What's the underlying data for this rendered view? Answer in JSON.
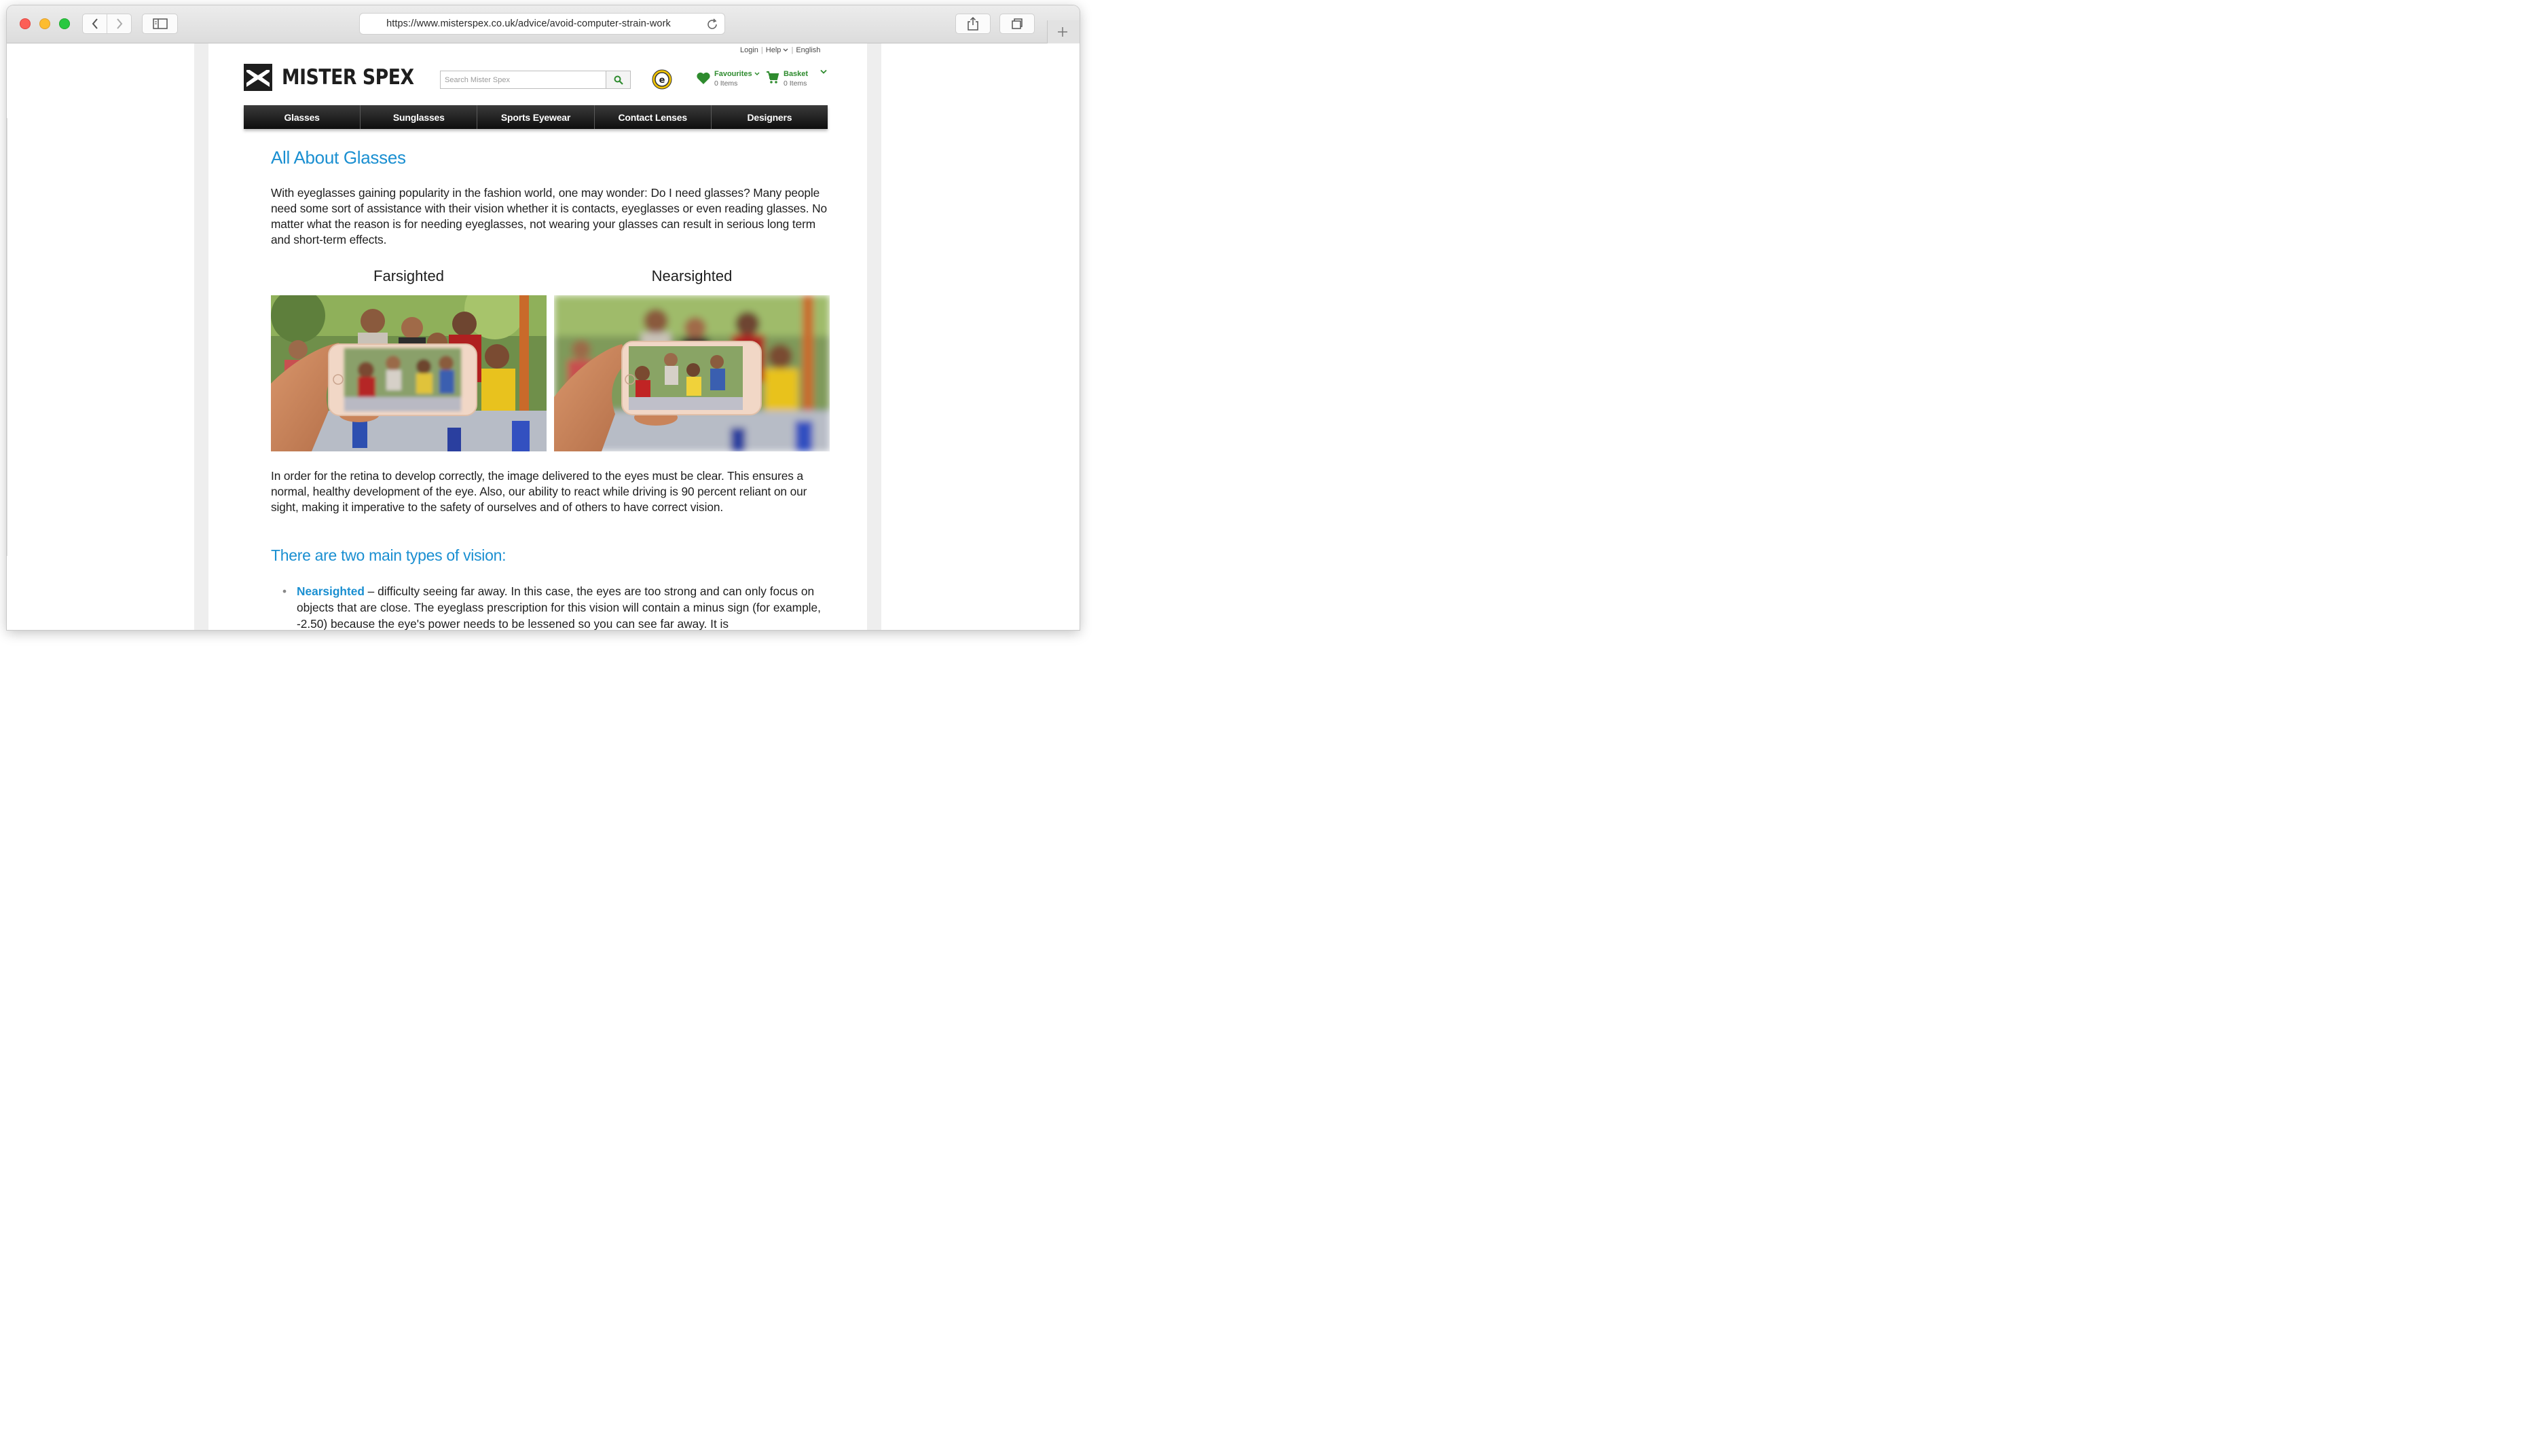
{
  "browser": {
    "url": "https://www.misterspex.co.uk/advice/avoid-computer-strain-work"
  },
  "site": {
    "top_links": [
      "Login",
      "Help",
      "English"
    ],
    "logo_text": "MISTER SPEX",
    "search_placeholder": "Search Mister Spex",
    "favourites": {
      "label": "Favourites",
      "count": "0 Items"
    },
    "basket": {
      "label": "Basket",
      "count": "0 Items"
    },
    "nav": [
      "Glasses",
      "Sunglasses",
      "Sports Eyewear",
      "Contact Lenses",
      "Designers"
    ]
  },
  "article": {
    "title": "All About Glasses",
    "intro": "With eyeglasses gaining popularity in the fashion world, one may wonder: Do I need glasses? Many people need some sort of assistance with their vision whether it is contacts, eyeglasses or even reading glasses. No matter what the reason is for needing eyeglasses, not wearing your glasses can result in serious long term and short-term effects.",
    "images": [
      {
        "caption": "Farsighted"
      },
      {
        "caption": "Nearsighted"
      }
    ],
    "para2": "In order for the retina to develop correctly, the image delivered to the eyes must be clear. This ensures a normal, healthy development of the eye. Also, our ability to react while driving is 90 percent reliant on our sight, making it imperative to the safety of ourselves and of others to have correct vision.",
    "subheading": "There are two main types of vision:",
    "bullets": [
      {
        "term": "Nearsighted",
        "text": " – difficulty seeing far away. In this case, the eyes are too strong and can only focus on objects that are close. The eyeglass prescription for this vision will contain a minus sign (for example, -2.50) because the eye's power needs to be lessened so you can see far away. It is"
      }
    ]
  },
  "colors": {
    "accent_blue": "#1a8fd1",
    "green": "#2e8b2e",
    "nav_bg": "#1c1c1c"
  }
}
